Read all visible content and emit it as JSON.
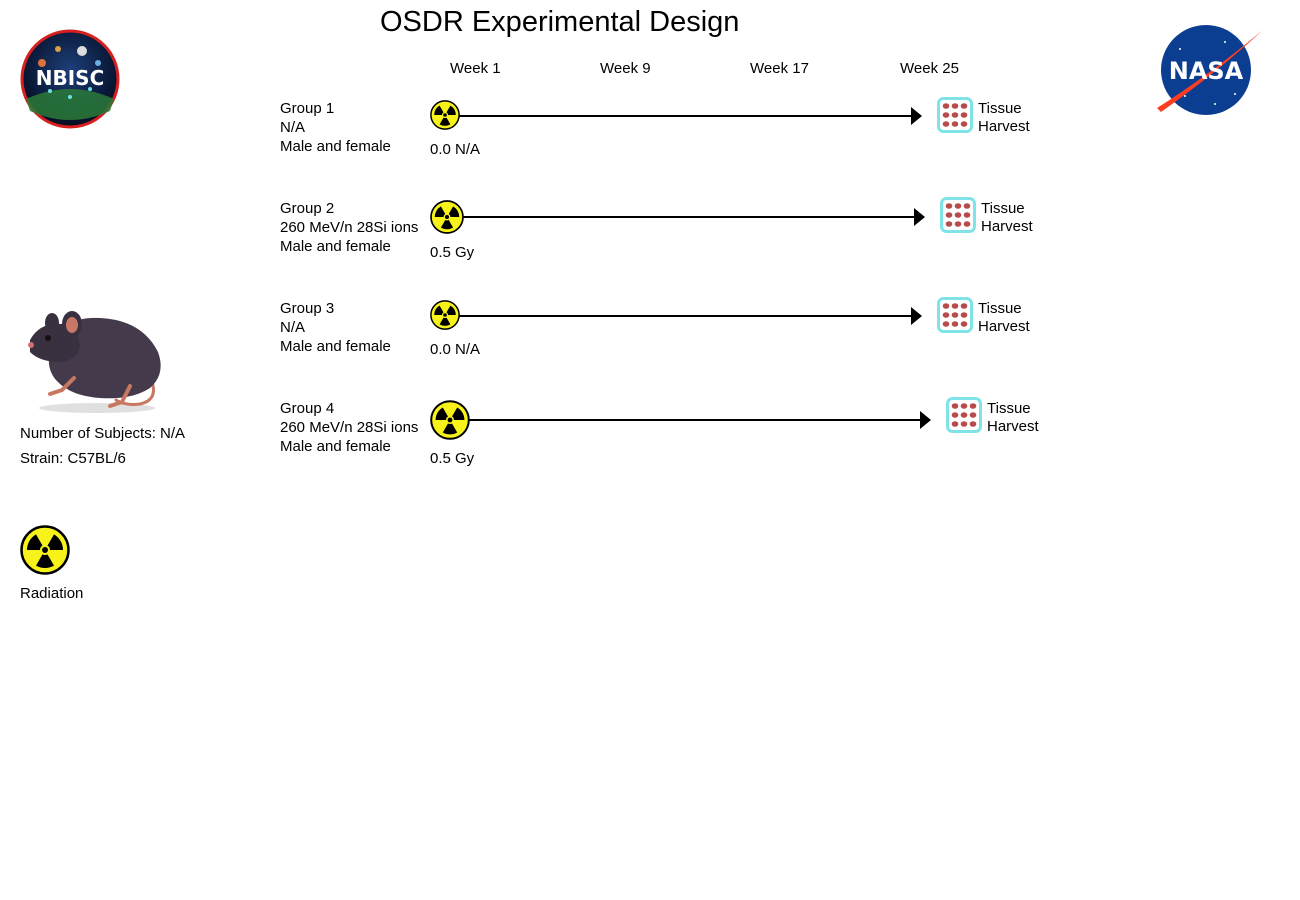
{
  "title": "OSDR Experimental Design",
  "logos": {
    "left": {
      "icon": "nbisc-logo",
      "text": "NBISC"
    },
    "right": {
      "icon": "nasa-logo",
      "text": "NASA"
    }
  },
  "timeline": {
    "weeks": [
      "Week 1",
      "Week 9",
      "Week 17",
      "Week 25"
    ]
  },
  "groups": [
    {
      "name": "Group 1",
      "radiation": "N/A",
      "sex": "Male and female",
      "dose": "0.0 N/A",
      "endpoint": [
        "Tissue",
        "Harvest"
      ]
    },
    {
      "name": "Group 2",
      "radiation": "260 MeV/n 28Si ions",
      "sex": "Male and female",
      "dose": "0.5 Gy",
      "endpoint": [
        "Tissue",
        "Harvest"
      ]
    },
    {
      "name": "Group 3",
      "radiation": "N/A",
      "sex": "Male and female",
      "dose": "0.0 N/A",
      "endpoint": [
        "Tissue",
        "Harvest"
      ]
    },
    {
      "name": "Group 4",
      "radiation": "260 MeV/n 28Si ions",
      "sex": "Male and female",
      "dose": "0.5 Gy",
      "endpoint": [
        "Tissue",
        "Harvest"
      ]
    }
  ],
  "subjects": {
    "icon": "mouse-icon",
    "count_label": "Number of Subjects: N/A",
    "strain_label": "Strain: C57BL/6"
  },
  "legend": {
    "icon": "radiation-icon",
    "label": "Radiation"
  },
  "colors": {
    "radiation_yellow": "#f7f21a",
    "nasa_blue": "#0b3d91",
    "nasa_red": "#fc3d21",
    "nbisc_ring": "#d62020",
    "tissue_frame": "#7fe3e8",
    "tissue_red": "#b84a4a"
  }
}
